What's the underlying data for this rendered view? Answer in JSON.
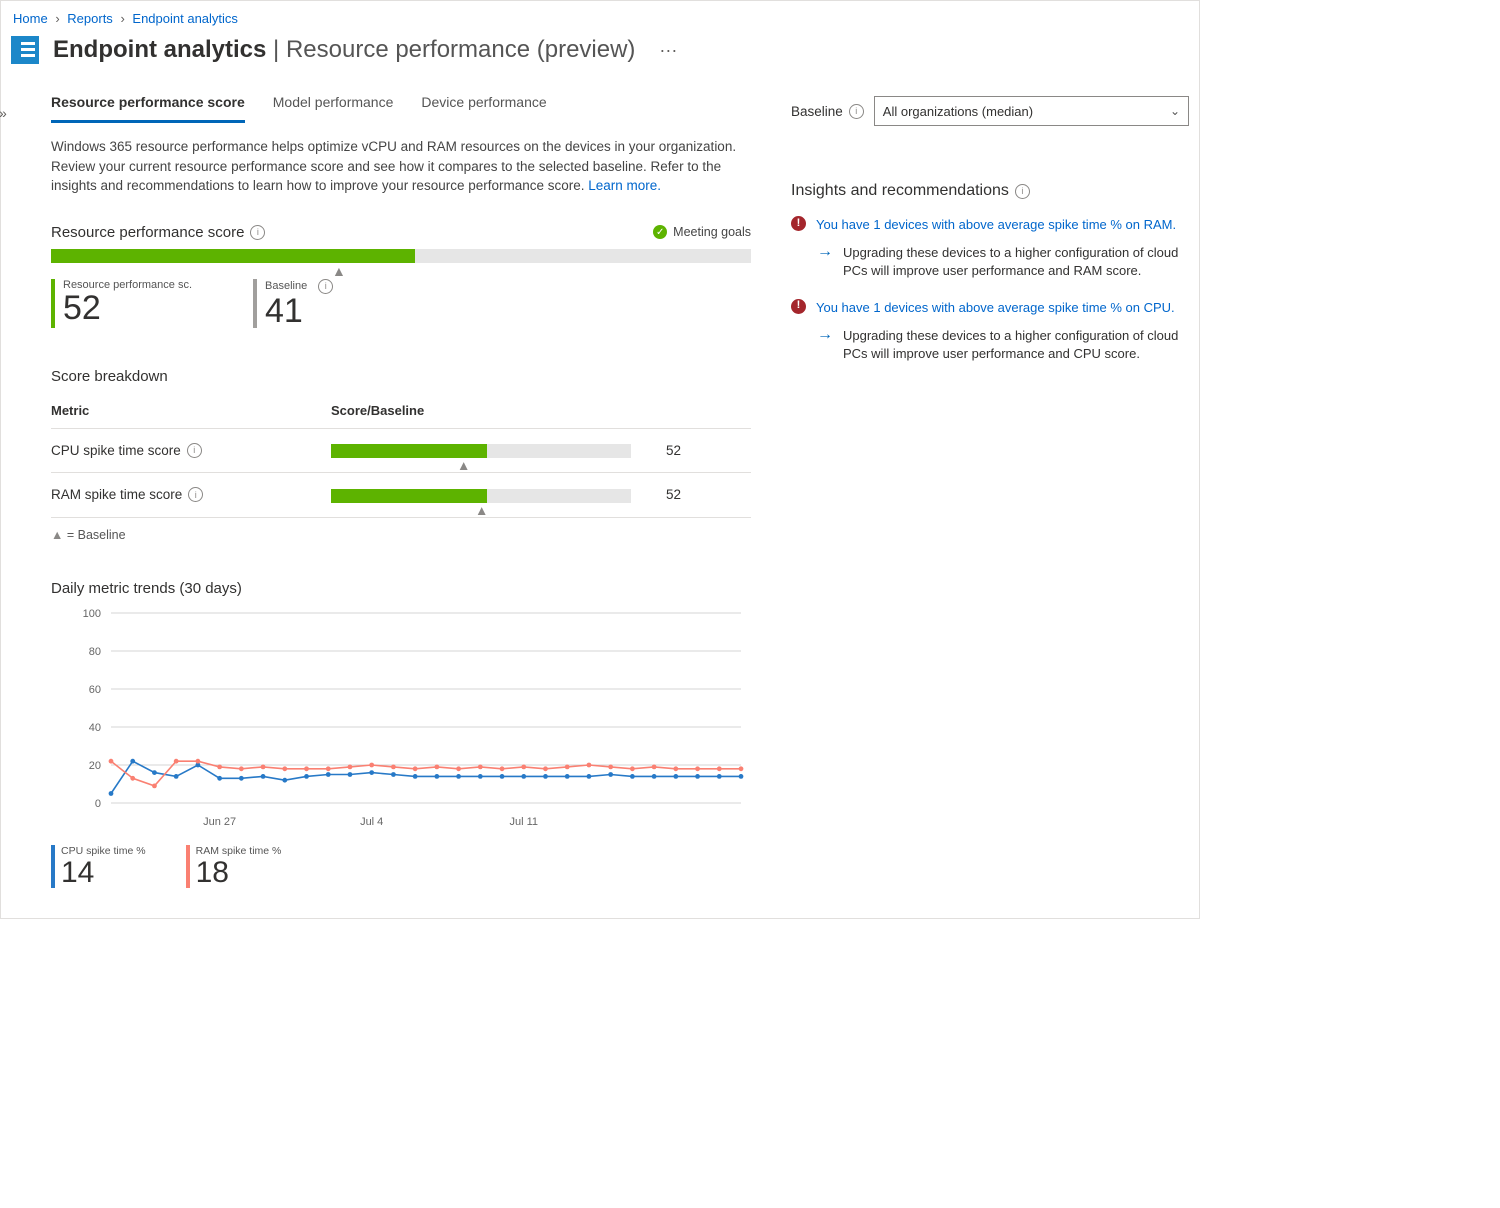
{
  "breadcrumb": {
    "items": [
      "Home",
      "Reports",
      "Endpoint analytics"
    ]
  },
  "title": {
    "main": "Endpoint analytics",
    "sub": "Resource performance (preview)"
  },
  "tabs": [
    {
      "label": "Resource performance score",
      "active": true
    },
    {
      "label": "Model performance",
      "active": false
    },
    {
      "label": "Device performance",
      "active": false
    }
  ],
  "description": {
    "text": "Windows 365 resource performance helps optimize vCPU and RAM resources on the devices in your organization. Review your current resource performance score and see how it compares to the selected baseline. Refer to the insights and recommendations to learn how to improve your resource performance score. ",
    "link": "Learn more."
  },
  "baseline": {
    "label": "Baseline",
    "selected": "All organizations (median)"
  },
  "score": {
    "header": "Resource performance score",
    "status": "Meeting goals",
    "value": 52,
    "baseline": 41,
    "kpi_score_label": "Resource performance sc...",
    "kpi_baseline_label": "Baseline"
  },
  "breakdown": {
    "header": "Score breakdown",
    "col_metric": "Metric",
    "col_score": "Score/Baseline",
    "rows": [
      {
        "metric": "CPU spike time score",
        "score": 52,
        "baseline": 44
      },
      {
        "metric": "RAM spike time score",
        "score": 52,
        "baseline": 50
      }
    ],
    "legend": "= Baseline"
  },
  "trends": {
    "header": "Daily metric trends (30 days)",
    "kpis": [
      {
        "label": "CPU spike time %",
        "value": 14,
        "color": "blue"
      },
      {
        "label": "RAM spike time %",
        "value": 18,
        "color": "orange"
      }
    ]
  },
  "chart_data": {
    "type": "line",
    "x": [
      1,
      2,
      3,
      4,
      5,
      6,
      7,
      8,
      9,
      10,
      11,
      12,
      13,
      14,
      15,
      16,
      17,
      18,
      19,
      20,
      21,
      22,
      23,
      24,
      25,
      26,
      27,
      28,
      29,
      30
    ],
    "x_tick_labels": {
      "6": "Jun 27",
      "13": "Jul 4",
      "20": "Jul 11"
    },
    "ylabel": "",
    "xlabel": "",
    "ylim": [
      0,
      100
    ],
    "y_ticks": [
      0,
      20,
      40,
      60,
      80,
      100
    ],
    "series": [
      {
        "name": "CPU spike time %",
        "color": "#2779c7",
        "values": [
          5,
          22,
          16,
          14,
          20,
          13,
          13,
          14,
          12,
          14,
          15,
          15,
          16,
          15,
          14,
          14,
          14,
          14,
          14,
          14,
          14,
          14,
          14,
          15,
          14,
          14,
          14,
          14,
          14,
          14
        ]
      },
      {
        "name": "RAM spike time %",
        "color": "#fa8072",
        "values": [
          22,
          13,
          9,
          22,
          22,
          19,
          18,
          19,
          18,
          18,
          18,
          19,
          20,
          19,
          18,
          19,
          18,
          19,
          18,
          19,
          18,
          19,
          20,
          19,
          18,
          19,
          18,
          18,
          18,
          18
        ]
      }
    ]
  },
  "insights": {
    "header": "Insights and recommendations",
    "items": [
      {
        "title": "You have 1 devices with above average spike time % on RAM.",
        "detail": "Upgrading these devices to a higher configuration of cloud PCs will improve user performance and RAM score."
      },
      {
        "title": "You have 1 devices with above average spike time % on CPU.",
        "detail": "Upgrading these devices to a higher configuration of cloud PCs will improve user performance and CPU score."
      }
    ]
  }
}
